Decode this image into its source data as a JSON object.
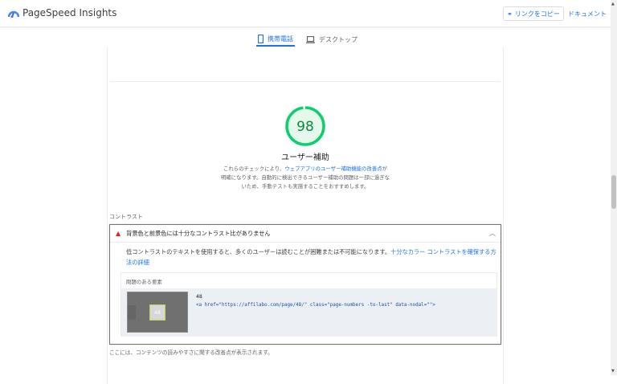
{
  "header": {
    "brand": "PageSpeed Insights",
    "copy_link": "リンクをコピー",
    "docs": "ドキュメント"
  },
  "tabs": [
    {
      "label": "携帯電話",
      "active": true
    },
    {
      "label": "デスクトップ",
      "active": false
    }
  ],
  "score": {
    "value": "98",
    "fraction": 0.98,
    "color": "#0cce6b",
    "title": "ユーザー補助",
    "desc_before": "これらのチェックにより、",
    "desc_link": "ウェブアプリのユーザー補助機能の改善点",
    "desc_after": "が明確になります。自動的に検出できるユーザー補助の問題は一部に過ぎないため、手動テストも実施することをおすすめします。"
  },
  "group_label": "コントラスト",
  "audit": {
    "title": "背景色と前景色には十分なコントラスト比がありません",
    "desc": "低コントラストのテキストを使用すると、多くのユーザーは読むことが困難または不可能になります。",
    "link": "十分なカラー コントラストを確保する方法の詳細",
    "table_header": "問題のある要素",
    "item": {
      "thumb_text": "48",
      "text": "48",
      "snippet": "<a href=\"https://affilabo.com/page/48/\" class=\"page-numbers -to-last\" data-nodal=\"\">"
    }
  },
  "footer": "ここには、コンテンツの読みやすさに関する改善点が表示されます。"
}
